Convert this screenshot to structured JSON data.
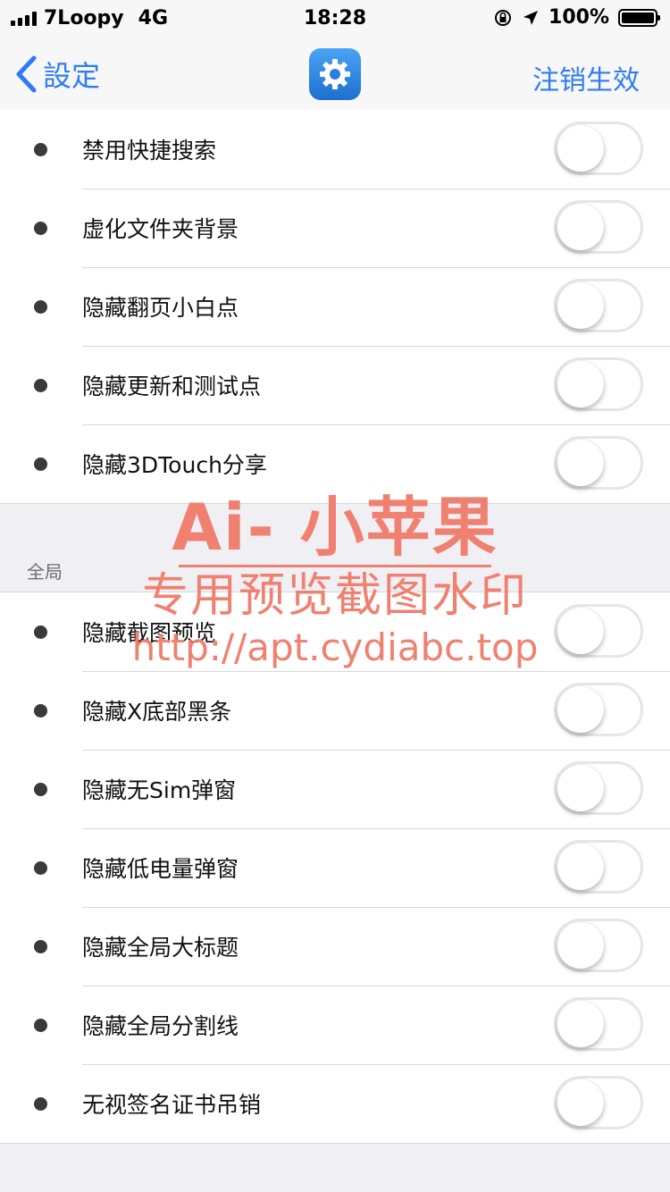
{
  "status_bar": {
    "carrier": "7Loopy",
    "network": "4G",
    "time": "18:28",
    "battery": "100%"
  },
  "nav": {
    "back_label": "設定",
    "action_label": "注销生效",
    "app_icon": "gear-icon"
  },
  "section1": {
    "items": [
      {
        "label": "禁用快捷搜索",
        "on": false
      },
      {
        "label": "虚化文件夹背景",
        "on": false
      },
      {
        "label": "隐藏翻页小白点",
        "on": false
      },
      {
        "label": "隐藏更新和测试点",
        "on": false
      },
      {
        "label": "隐藏3DTouch分享",
        "on": false
      }
    ]
  },
  "section2": {
    "header": "全局",
    "items": [
      {
        "label": "隐藏截图预览",
        "on": false
      },
      {
        "label": "隐藏X底部黑条",
        "on": false
      },
      {
        "label": "隐藏无Sim弹窗",
        "on": false
      },
      {
        "label": "隐藏低电量弹窗",
        "on": false
      },
      {
        "label": "隐藏全局大标题",
        "on": false
      },
      {
        "label": "隐藏全局分割线",
        "on": false
      },
      {
        "label": "无视签名证书吊销",
        "on": false
      }
    ]
  },
  "watermark": {
    "line1": "Ai- 小苹果",
    "line2": "专用预览截图水印",
    "line3": "http://apt.cydiabc.top"
  },
  "colors": {
    "accent": "#2d7cf6",
    "background": "#efeff4",
    "watermark": "#f08070"
  }
}
